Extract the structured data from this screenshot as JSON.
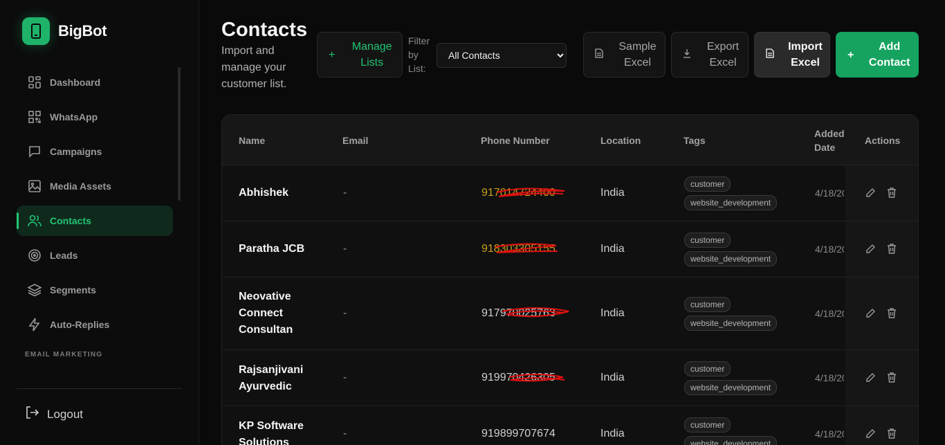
{
  "brand": {
    "name": "BigBot"
  },
  "nav": {
    "items": [
      {
        "label": "Dashboard",
        "icon": "grid-icon"
      },
      {
        "label": "WhatsApp",
        "icon": "qr-icon"
      },
      {
        "label": "Campaigns",
        "icon": "chat-icon"
      },
      {
        "label": "Media Assets",
        "icon": "image-icon"
      },
      {
        "label": "Contacts",
        "icon": "users-icon",
        "active": true
      },
      {
        "label": "Leads",
        "icon": "target-icon"
      },
      {
        "label": "Segments",
        "icon": "layers-icon"
      },
      {
        "label": "Auto-Replies",
        "icon": "bolt-icon"
      }
    ],
    "section_label": "EMAIL MARKETING",
    "logout_label": "Logout"
  },
  "header": {
    "title": "Contacts",
    "subtitle": "Import and manage your customer list.",
    "manage_lists": "Manage Lists",
    "filter_label": "Filter by List:",
    "filter_value": "All Contacts",
    "sample_excel": "Sample Excel",
    "export_excel": "Export Excel",
    "import_excel": "Import Excel",
    "add_contact": "Add Contact"
  },
  "table": {
    "columns": [
      "Name",
      "Email",
      "Phone Number",
      "Location",
      "Tags",
      "Added Date",
      "Actions"
    ],
    "rows": [
      {
        "name": "Abhishek",
        "email": "-",
        "phone": "917014724400",
        "location": "India",
        "tags": [
          "customer",
          "website_development"
        ],
        "date": "4/18/20"
      },
      {
        "name": "Paratha JCB",
        "email": "-",
        "phone": "918303305155",
        "location": "India",
        "tags": [
          "customer",
          "website_development"
        ],
        "date": "4/18/20"
      },
      {
        "name": "Neovative Connect Consultan",
        "email": "-",
        "phone": "917970025763",
        "location": "India",
        "tags": [
          "customer",
          "website_development"
        ],
        "date": "4/18/20"
      },
      {
        "name": "Rajsanjivani Ayurvedic",
        "email": "-",
        "phone": "919970426305",
        "location": "India",
        "tags": [
          "customer",
          "website_development"
        ],
        "date": "4/18/20"
      },
      {
        "name": "KP Software Solutions",
        "email": "-",
        "phone": "919899707674",
        "location": "India",
        "tags": [
          "customer",
          "website_development"
        ],
        "date": "4/18/20"
      }
    ]
  },
  "colors": {
    "accent": "#22c472",
    "add_button": "#15a35f",
    "background": "#0a0a0a",
    "redaction": "#e01010"
  }
}
